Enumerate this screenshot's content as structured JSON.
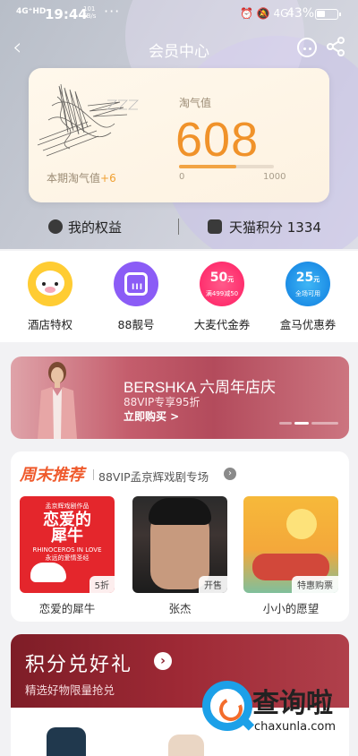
{
  "status_bar": {
    "signal": "4G⁺HD",
    "time": "19:44",
    "speed_value": "101",
    "speed_unit": "KB/s",
    "more": "···",
    "right_icons": "⏰ 🔕 4G⁺",
    "battery": "43%",
    "battery_level": 0.43
  },
  "nav": {
    "back": "‹",
    "title": "会员中心"
  },
  "card": {
    "period_label": "本期淘气值",
    "period_delta": "+6",
    "qq_label": "淘气值",
    "qq_value": "608",
    "progress": 0.608,
    "range_min": "0",
    "range_max": "1000"
  },
  "rights": {
    "my_rights": "我的权益",
    "points_label": "天猫积分 1334"
  },
  "quick_entries": [
    {
      "label": "酒店特权",
      "icon": "pig-icon"
    },
    {
      "label": "88靓号",
      "icon": "sim-card-icon",
      "badge": "III"
    },
    {
      "label": "大麦代金券",
      "icon": "damai-coupon-icon",
      "amount": "50",
      "unit": "元",
      "note": "满499减50"
    },
    {
      "label": "盒马优惠券",
      "icon": "hema-coupon-icon",
      "amount": "25",
      "unit": "元",
      "note": "全场可用"
    }
  ],
  "banner": {
    "title": "BERSHKA 六周年店庆",
    "subtitle": "88VIP专享95折",
    "cta": "立即购买 >"
  },
  "weekend": {
    "title": "周末推荐",
    "subtitle": "88VIP孟京辉戏剧专场",
    "arrow": "›",
    "shows": [
      {
        "name": "恋爱的犀牛",
        "tag": "5折",
        "poster_top": "孟京辉戏剧作品",
        "poster_title": "恋爱的\n犀牛",
        "poster_sub": "RHINOCEROS IN LOVE\n永远的爱情圣经"
      },
      {
        "name": "张杰",
        "tag": "开售"
      },
      {
        "name": "小小的愿望",
        "tag": "特惠购票"
      }
    ]
  },
  "exchange": {
    "title": "积分兑好礼",
    "arrow": "›",
    "subtitle": "精选好物限量抢兑"
  },
  "watermark": {
    "text": "查询啦",
    "url": "chaxunla.com"
  },
  "colors": {
    "accent_orange": "#f0922a",
    "banner_red": "#b34b5c",
    "exchange_red": "#9e2935",
    "weekend_orange": "#ef5a2c"
  }
}
